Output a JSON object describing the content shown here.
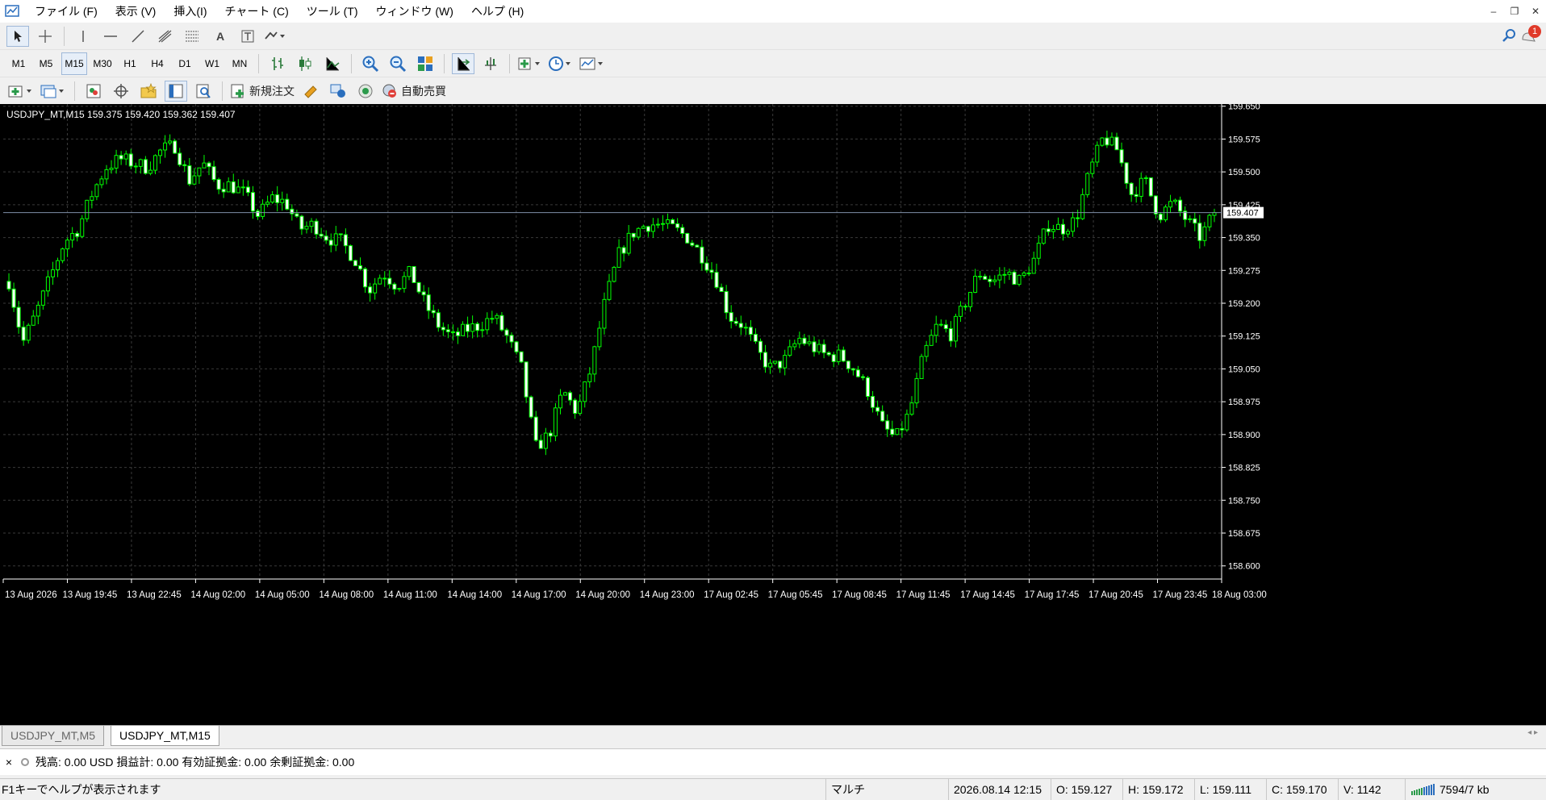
{
  "menu": [
    "ファイル (F)",
    "表示 (V)",
    "挿入(I)",
    "チャート (C)",
    "ツール (T)",
    "ウィンドウ (W)",
    "ヘルプ (H)"
  ],
  "window_controls": [
    "–",
    "❐",
    "✕"
  ],
  "notification_count": "1",
  "timeframes": [
    "M1",
    "M5",
    "M15",
    "M30",
    "H1",
    "H4",
    "D1",
    "W1",
    "MN"
  ],
  "active_timeframe": "M15",
  "toolbar3": {
    "new_order": "新規注文",
    "auto_trading": "自動売買"
  },
  "chart": {
    "title": "USDJPY_MT,M15  159.375 159.420 159.362 159.407",
    "current_price_label": "159.407",
    "current_price": 159.407,
    "background": "#000000",
    "candle_color": "#00ff00",
    "grid_color": "#3a3a3a"
  },
  "chart_data": {
    "type": "candlestick",
    "price_range": [
      158.57,
      159.655
    ],
    "y_ticks": [
      "159.650",
      "159.575",
      "159.500",
      "159.425",
      "159.350",
      "159.275",
      "159.200",
      "159.125",
      "159.050",
      "158.975",
      "158.900",
      "158.825",
      "158.750",
      "158.675",
      "158.600"
    ],
    "x_ticks": [
      "13 Aug 2026",
      "13 Aug 19:45",
      "13 Aug 22:45",
      "14 Aug 02:00",
      "14 Aug 05:00",
      "14 Aug 08:00",
      "14 Aug 11:00",
      "14 Aug 14:00",
      "14 Aug 17:00",
      "14 Aug 20:00",
      "14 Aug 23:00",
      "17 Aug 02:45",
      "17 Aug 05:45",
      "17 Aug 08:45",
      "17 Aug 11:45",
      "17 Aug 14:45",
      "17 Aug 17:45",
      "17 Aug 20:45",
      "17 Aug 23:45",
      "18 Aug 03:00"
    ],
    "close_path": [
      159.25,
      159.11,
      159.18,
      159.26,
      159.34,
      159.37,
      159.45,
      159.51,
      159.53,
      159.52,
      159.51,
      159.55,
      159.56,
      159.48,
      159.52,
      159.47,
      159.47,
      159.45,
      159.4,
      159.44,
      159.43,
      159.37,
      159.38,
      159.35,
      159.34,
      159.3,
      159.23,
      159.27,
      159.24,
      159.27,
      159.2,
      159.15,
      159.12,
      159.14,
      159.15,
      159.17,
      159.12,
      159.05,
      158.87,
      158.9,
      159.0,
      158.95,
      159.05,
      159.2,
      159.31,
      159.36,
      159.38,
      159.38,
      159.37,
      159.35,
      159.31,
      159.26,
      159.17,
      159.15,
      159.09,
      159.05,
      159.07,
      159.12,
      159.1,
      159.08,
      159.08,
      159.05,
      159.0,
      158.92,
      158.89,
      158.95,
      159.08,
      159.15,
      159.13,
      159.2,
      159.27,
      159.25,
      159.27,
      159.25,
      159.3,
      159.38,
      159.37,
      159.39,
      159.5,
      159.58,
      159.55,
      159.45,
      159.48,
      159.4,
      159.43,
      159.39,
      159.35,
      159.407
    ]
  },
  "tabs": [
    "USDJPY_MT,M5",
    "USDJPY_MT,M15"
  ],
  "active_tab": "USDJPY_MT,M15",
  "terminal": {
    "close_glyph": "×",
    "summary": "残高: 0.00 USD  損益計: 0.00  有効証拠金: 0.00  余剰証拠金: 0.00"
  },
  "status": {
    "help": "F1キーでヘルプが表示されます",
    "profile": "マルチ",
    "datetime": "2026.08.14 12:15",
    "open": "O: 159.127",
    "high": "H: 159.172",
    "low": "L: 159.111",
    "close": "C: 159.170",
    "volume": "V: 1142",
    "connection": "7594/7 kb"
  }
}
